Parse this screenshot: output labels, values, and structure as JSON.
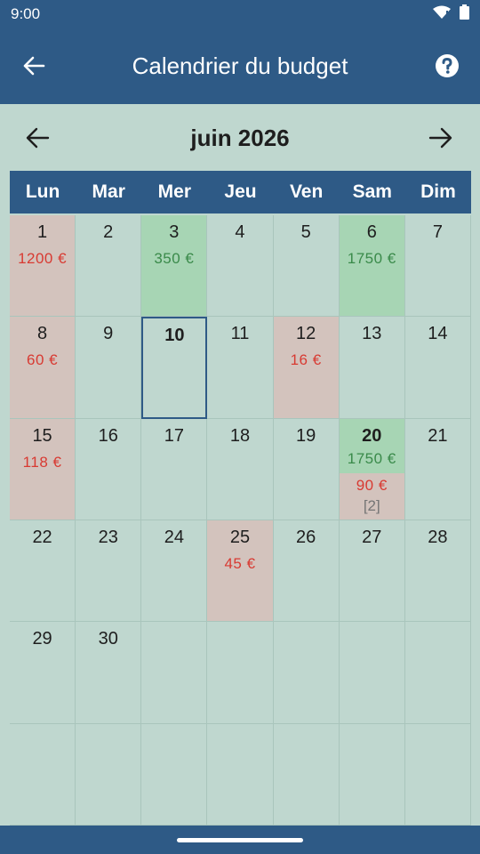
{
  "status_bar": {
    "time": "9:00"
  },
  "app_bar": {
    "title": "Calendrier du budget"
  },
  "month_nav": {
    "title": "juin 2026"
  },
  "weekdays": [
    "Lun",
    "Mar",
    "Mer",
    "Jeu",
    "Ven",
    "Sam",
    "Dim"
  ],
  "cells": [
    {
      "day": "1",
      "type": "expense",
      "amount": "1200 €",
      "amount_color": "red"
    },
    {
      "day": "2"
    },
    {
      "day": "3",
      "type": "income",
      "amount": "350 €",
      "amount_color": "green"
    },
    {
      "day": "4"
    },
    {
      "day": "5"
    },
    {
      "day": "6",
      "type": "income",
      "amount": "1750 €",
      "amount_color": "green"
    },
    {
      "day": "7"
    },
    {
      "day": "8",
      "type": "expense",
      "amount": "60 €",
      "amount_color": "red"
    },
    {
      "day": "9"
    },
    {
      "day": "10",
      "today": true
    },
    {
      "day": "11"
    },
    {
      "day": "12",
      "type": "expense",
      "amount": "16 €",
      "amount_color": "red"
    },
    {
      "day": "13"
    },
    {
      "day": "14"
    },
    {
      "day": "15",
      "type": "expense",
      "amount": "118 €",
      "amount_color": "red"
    },
    {
      "day": "16"
    },
    {
      "day": "17"
    },
    {
      "day": "18"
    },
    {
      "day": "19"
    },
    {
      "day": "20",
      "type": "split",
      "income_amount": "1750 €",
      "expense_amount": "90 €",
      "count": "[2]"
    },
    {
      "day": "21"
    },
    {
      "day": "22"
    },
    {
      "day": "23"
    },
    {
      "day": "24"
    },
    {
      "day": "25",
      "type": "expense",
      "amount": "45 €",
      "amount_color": "red"
    },
    {
      "day": "26"
    },
    {
      "day": "27"
    },
    {
      "day": "28"
    },
    {
      "day": "29"
    },
    {
      "day": "30"
    },
    {
      "day": ""
    },
    {
      "day": ""
    },
    {
      "day": ""
    },
    {
      "day": ""
    },
    {
      "day": ""
    },
    {
      "day": ""
    },
    {
      "day": ""
    },
    {
      "day": ""
    },
    {
      "day": ""
    },
    {
      "day": ""
    },
    {
      "day": ""
    },
    {
      "day": ""
    }
  ],
  "colors": {
    "primary": "#2e5a86",
    "background": "#bfd7cf",
    "expense_bg": "#d3c3bd",
    "income_bg": "#a7d5b4",
    "expense_text": "#d83a32",
    "income_text": "#3a8a4a"
  }
}
